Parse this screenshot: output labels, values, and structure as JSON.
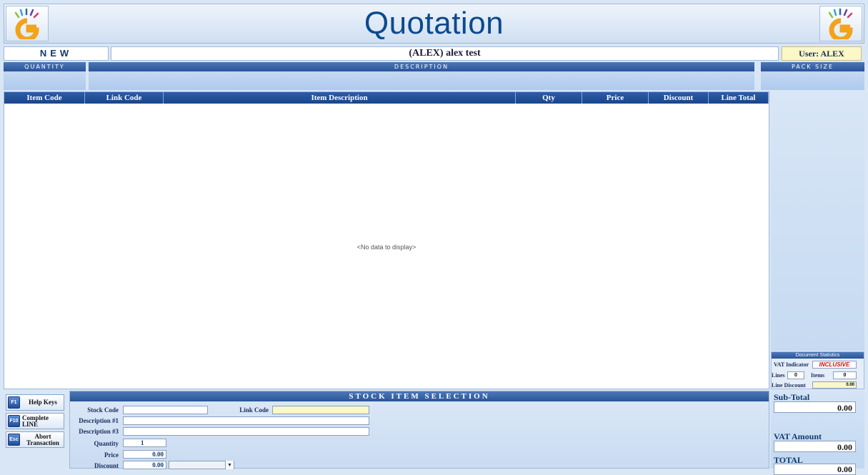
{
  "header": {
    "title": "Quotation"
  },
  "info": {
    "mode": "NEW",
    "client": "(ALEX)  alex test",
    "user": "User: ALEX"
  },
  "entry_strip": {
    "quantity": "QUANTITY",
    "description": "DESCRIPTION",
    "pack_size": "PACK SIZE"
  },
  "grid": {
    "columns": [
      "Item Code",
      "Link Code",
      "Item Description",
      "Qty",
      "Price",
      "Discount",
      "Line Total"
    ],
    "empty_text": "<No data to display>"
  },
  "stats": {
    "title": "Document Statistics",
    "vat_indicator_label": "VAT Indicator",
    "vat_indicator_value": "INCLUSIVE",
    "lines_label": "Lines",
    "lines_value": "0",
    "items_label": "Items",
    "items_value": "0",
    "line_discount_label": "Line Discount",
    "line_discount_value": "0.00"
  },
  "totals": {
    "subtotal_label": "Sub-Total",
    "subtotal_value": "0.00",
    "vat_label": "VAT Amount",
    "vat_value": "0.00",
    "total_label": "TOTAL",
    "total_value": "0.00"
  },
  "keys": {
    "help": {
      "key": "F1",
      "label": "Help Keys"
    },
    "complete": {
      "key": "F10",
      "label": "Complete LINE"
    },
    "abort": {
      "key": "Esc",
      "label": "Abort Transaction"
    }
  },
  "selection": {
    "title": "STOCK ITEM SELECTION",
    "stock_code_label": "Stock Code",
    "stock_code_value": "",
    "link_code_label": "Link Code",
    "link_code_value": "",
    "desc1_label": "Description #1",
    "desc1_value": "",
    "desc3_label": "Description #3",
    "desc3_value": "",
    "quantity_label": "Quantity",
    "quantity_value": "1",
    "price_label": "Price",
    "price_value": "0.00",
    "discount_label": "Discount",
    "discount_value": "0.00",
    "discount_type_value": ""
  },
  "colors": {
    "accent": "#1b4589",
    "title": "#0b4a8e",
    "user_bg": "#fbf7c6",
    "inclusive": "#d01010"
  }
}
